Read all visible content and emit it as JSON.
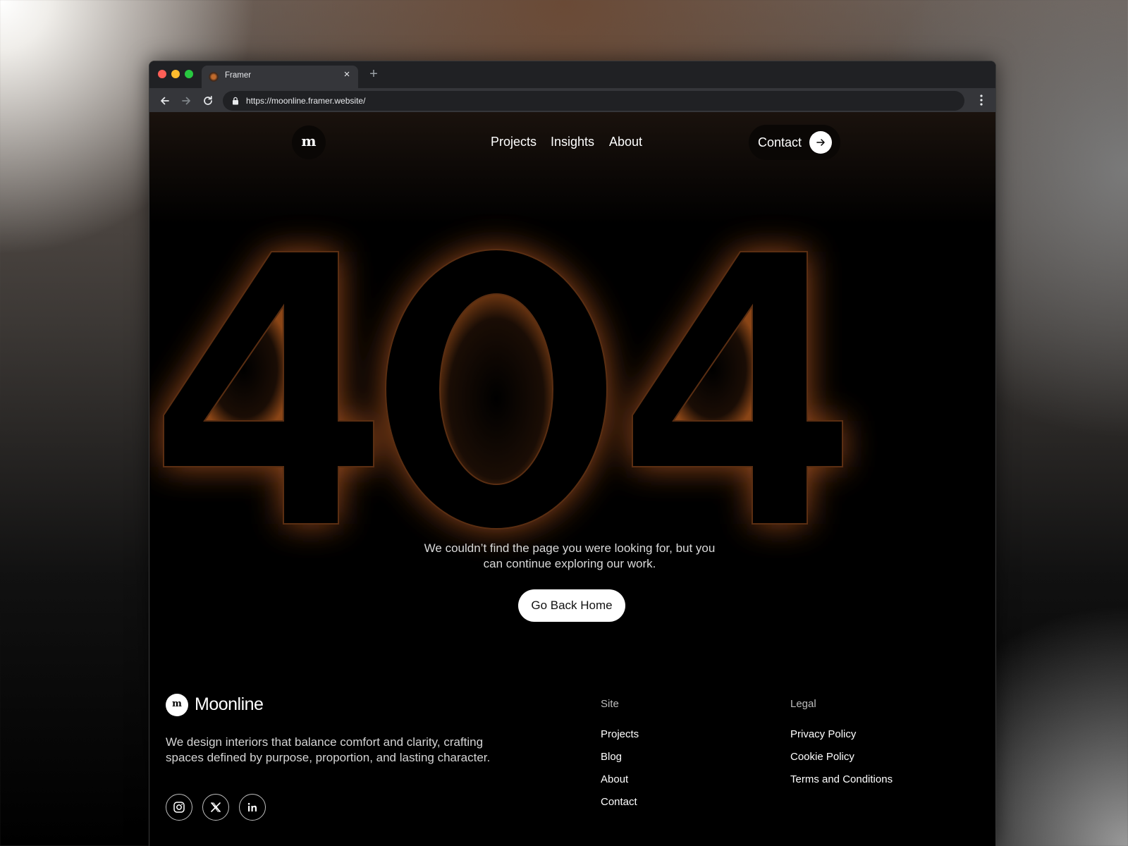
{
  "browser": {
    "tab_title": "Framer",
    "url": "https://moonline.framer.website/"
  },
  "nav": {
    "logo_letter": "m",
    "links": [
      {
        "label": "Projects"
      },
      {
        "label": "Insights"
      },
      {
        "label": "About"
      }
    ],
    "contact_label": "Contact"
  },
  "error": {
    "code": "404",
    "message": "We couldn’t find the page you were looking for, but you can continue exploring our work.",
    "button_label": "Go Back Home"
  },
  "footer": {
    "logo_letter": "m",
    "brand": "Moonline",
    "description": "We design interiors that balance comfort and clarity, crafting spaces defined by purpose, proportion, and lasting character.",
    "social": [
      "instagram-icon",
      "x-icon",
      "linkedin-icon"
    ],
    "site": {
      "heading": "Site",
      "links": [
        "Projects",
        "Blog",
        "About",
        "Contact"
      ]
    },
    "legal": {
      "heading": "Legal",
      "links": [
        "Privacy Policy",
        "Cookie Policy",
        "Terms and Conditions"
      ]
    }
  },
  "colors": {
    "background": "#000000",
    "glow": "#c8672a",
    "button": "#ffffff"
  }
}
